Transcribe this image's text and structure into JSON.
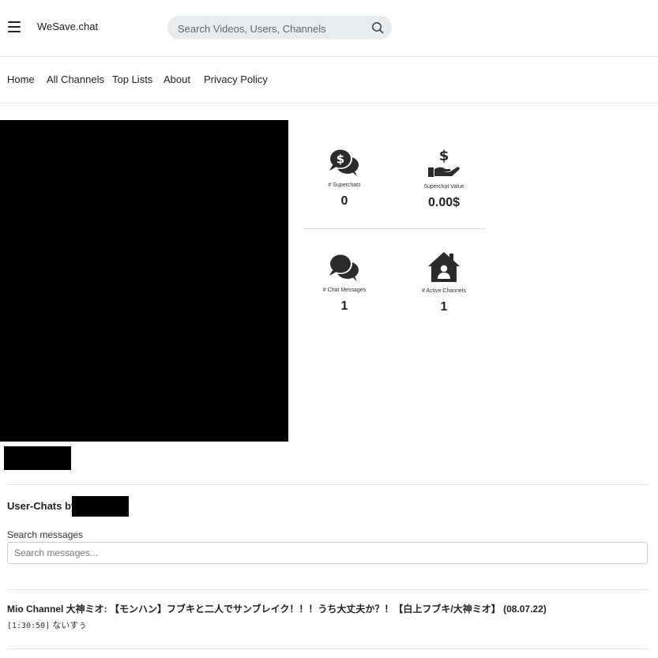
{
  "header": {
    "brand": "WeSave.chat",
    "search_placeholder": "Search Videos, Users, Channels"
  },
  "nav": {
    "items": [
      {
        "label": "Home"
      },
      {
        "label": "All Channels"
      },
      {
        "label": "Top Lists"
      },
      {
        "label": "About"
      },
      {
        "label": "Privacy Policy"
      }
    ]
  },
  "stats": {
    "superchats": {
      "label": "# Superchats",
      "value": "0",
      "icon": "money-chat-icon"
    },
    "superchat_value": {
      "label": "Superchat Value",
      "value": "0.00$",
      "icon": "hand-dollar-icon"
    },
    "chat_messages": {
      "label": "# Chat Messages",
      "value": "1",
      "icon": "chat-bubbles-icon"
    },
    "active_channels": {
      "label": "# Active Channels",
      "value": "1",
      "icon": "house-user-icon"
    }
  },
  "chats": {
    "title": "User-Chats by",
    "search_label": "Search messages",
    "search_placeholder": "Search messages...",
    "entries": [
      {
        "video": "Mio Channel 大神ミオ: 【モンハン】フブキと二人でサンブレイク！！！うち大丈夫か？！【白上フブキ/大神ミオ】 (08.07.22)",
        "timestamp": "[1:30:50]",
        "text": "ないすぅ"
      }
    ]
  },
  "colors": {
    "icon": "#2b2b2b",
    "search_bg": "#e9ecef",
    "redacted": "#000000"
  }
}
